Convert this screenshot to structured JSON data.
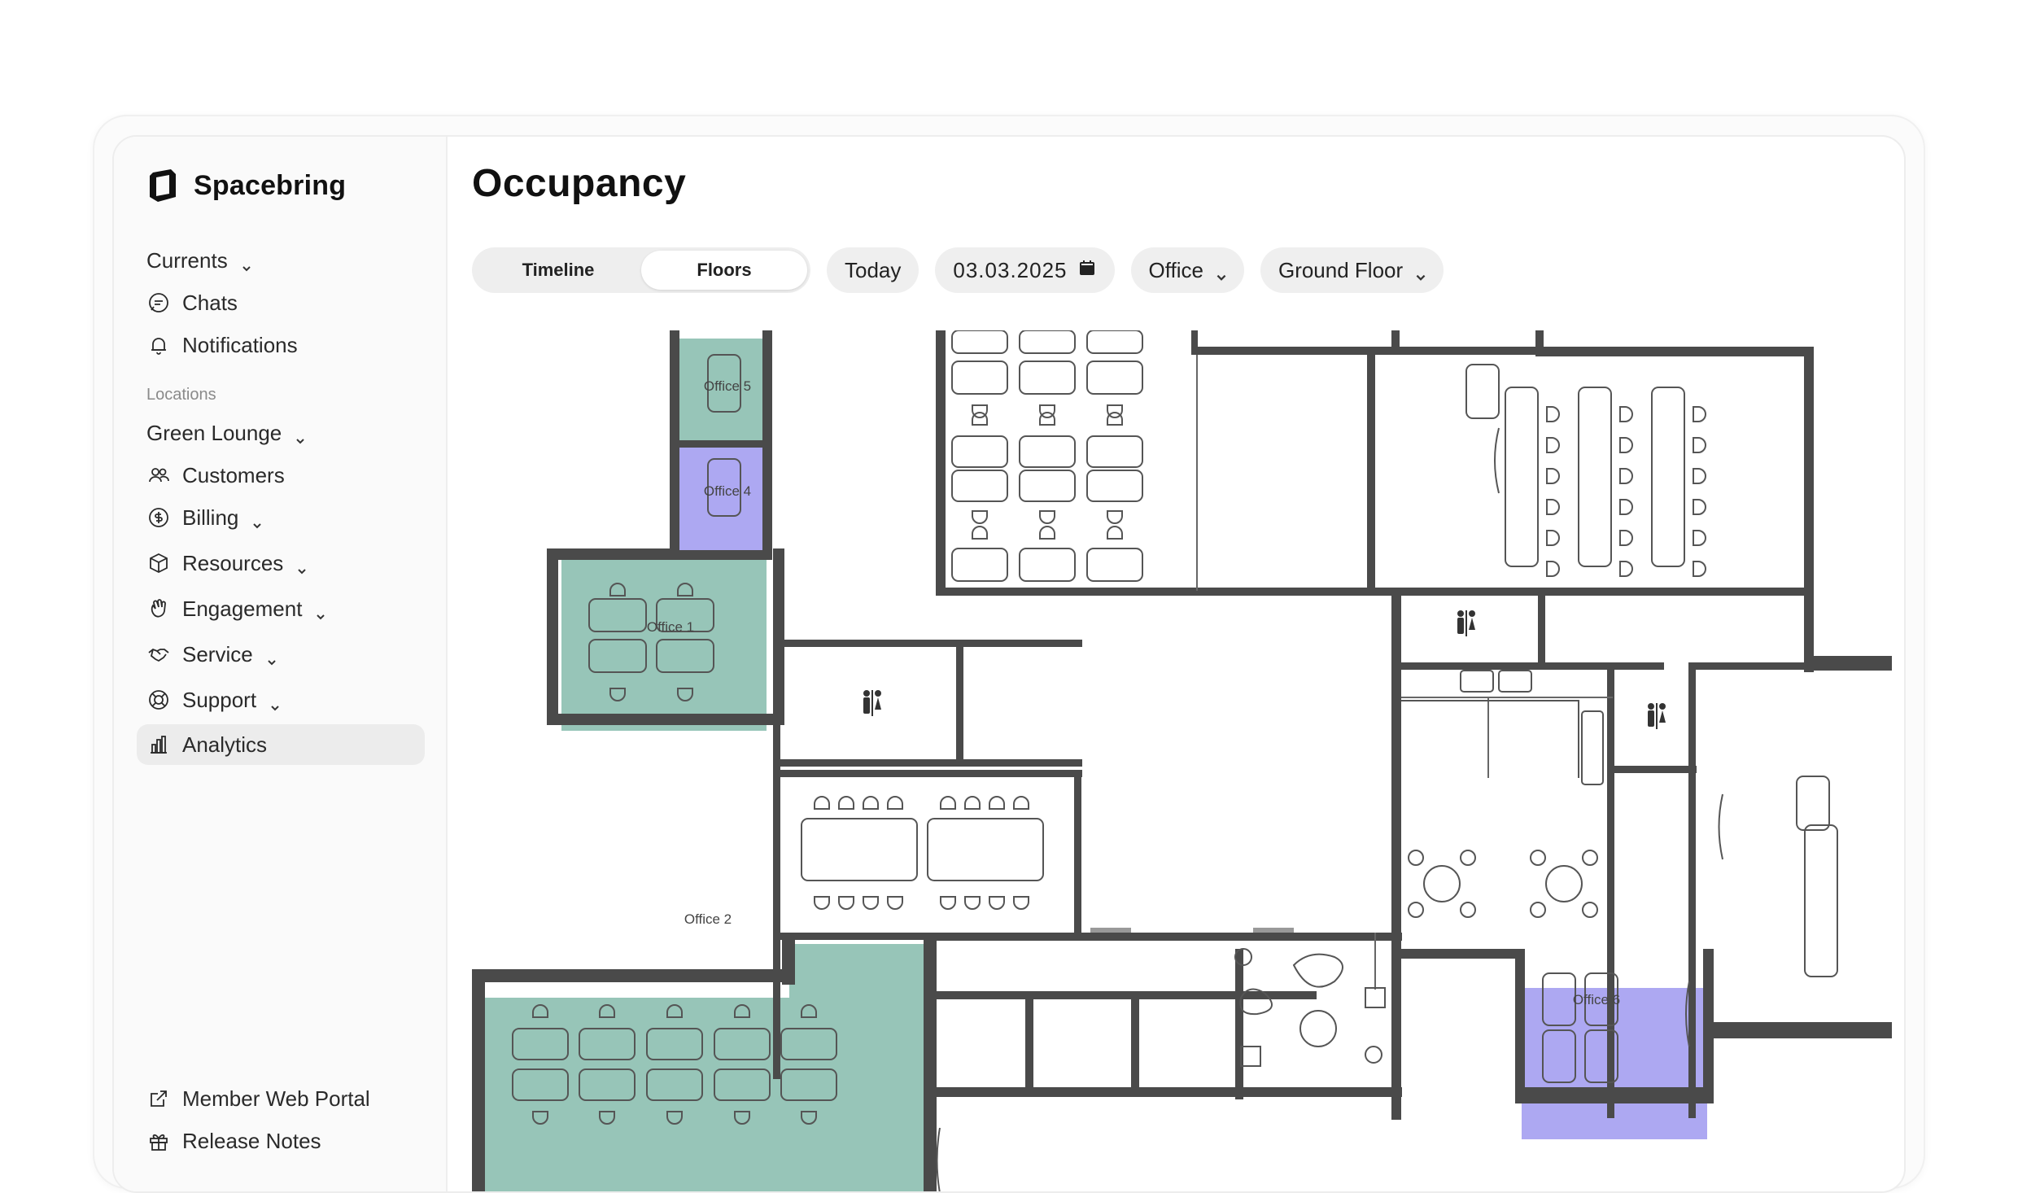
{
  "brand": {
    "name": "Spacebring"
  },
  "sidebar": {
    "group_currents": "Currents",
    "items_top": [
      {
        "label": "Chats"
      },
      {
        "label": "Notifications"
      }
    ],
    "section_label": "Locations",
    "location_selector": "Green Lounge",
    "items_location": [
      {
        "label": "Customers"
      },
      {
        "label": "Billing"
      },
      {
        "label": "Resources"
      },
      {
        "label": "Engagement"
      },
      {
        "label": "Service"
      },
      {
        "label": "Support"
      },
      {
        "label": "Analytics",
        "active": true
      }
    ],
    "items_bottom": [
      {
        "label": "Member Web Portal"
      },
      {
        "label": "Release Notes"
      }
    ]
  },
  "main": {
    "title": "Occupancy",
    "tabs": [
      {
        "label": "Timeline",
        "active": false
      },
      {
        "label": "Floors",
        "active": true
      }
    ],
    "today_label": "Today",
    "date_value": "03.03.2025",
    "resource_type": "Office",
    "floor": "Ground Floor"
  },
  "floorplan": {
    "rooms": [
      {
        "name": "Office 5",
        "status": "occupied"
      },
      {
        "name": "Office 4",
        "status": "booked"
      },
      {
        "name": "Office 1",
        "status": "occupied"
      },
      {
        "name": "Office 2",
        "status": "occupied"
      },
      {
        "name": "Office 6",
        "status": "booked"
      }
    ],
    "colors": {
      "occupied": "#97c5b8",
      "booked": "#ada8f2",
      "wall": "#4a4a4a",
      "fixture_stroke": "#555555"
    }
  }
}
